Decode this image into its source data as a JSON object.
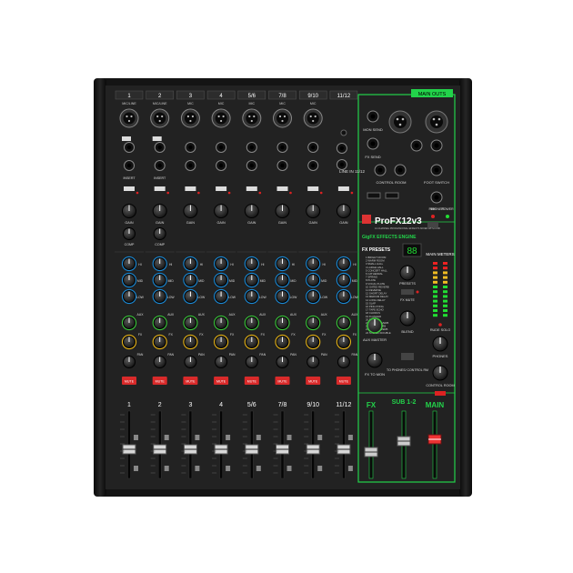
{
  "product": {
    "brand_logo": "mackie-badge-icon",
    "model": "ProFX12v3",
    "tagline": "12-CHANNEL PROFESSIONAL EFFECTS MIXER WITH USB",
    "fx_engine_label": "GigFX EFFECTS ENGINE"
  },
  "channels": [
    {
      "num": "1",
      "top": "MIC/LINE"
    },
    {
      "num": "2",
      "top": "MIC/LINE"
    },
    {
      "num": "3",
      "top": "MIC"
    },
    {
      "num": "4",
      "top": "MIC"
    },
    {
      "num": "5/6",
      "top": "MIC"
    },
    {
      "num": "7/8",
      "top": "MIC"
    },
    {
      "num": "9/10",
      "top": "MIC"
    },
    {
      "num": "11/12",
      "top": ""
    }
  ],
  "channel_labels": {
    "insert": "INSERT",
    "gain": "GAIN",
    "comp": "COMP",
    "eq_hi": "HI",
    "eq_mid": "MID",
    "eq_low": "LOW",
    "aux": "AUX",
    "fx": "FX",
    "pan": "PAN",
    "mute": "MUTE",
    "line_in_11_12": "LINE IN 11/12"
  },
  "main_section": {
    "main_outs": "MAIN OUTS",
    "mon_send": "MON SEND",
    "fx_send": "FX SEND",
    "control_room": "CONTROL ROOM",
    "foot_switch": "FOOT SWITCH",
    "phones": "PHONES",
    "power_48v": "48V",
    "power": "POWER",
    "fx_presets": "FX PRESETS",
    "preset_display": "88",
    "presets": "PRESETS",
    "fx_mute": "FX MUTE",
    "main_meters": "MAIN METERS",
    "blend": "BLEND",
    "rude_solo": "RUDE SOLO",
    "aux_master": "AUX MASTER",
    "fx_to_mon": "FX TO MON",
    "to_phones": "TO PHONES/ CONTROL RM",
    "control_room_knob": "CONTROL ROOM",
    "phones_knob": "PHONES",
    "fader_fx": "FX",
    "fader_sub": "SUB 1-2",
    "fader_main": "MAIN"
  },
  "fx_preset_list": [
    "BRIGHT ROOM",
    "WARM ROOM",
    "SMALL HALL",
    "LARGE HALL",
    "CONCERT HALL",
    "CATHEDRAL",
    "SPRING",
    "PLATE",
    "VOCAL PLATE",
    "GATED REVERB",
    "REVERSE",
    "SHORT DELAY",
    "MEDIUM DELAY",
    "LONG DELAY",
    "SLAP",
    "PING PONG",
    "TAPE ECHO",
    "CHORUS",
    "FLANGER",
    "PHASER",
    "CHORUS+VERB",
    "DELAY+VERB",
    "FLANGE+VERB",
    "STEREO DOUBLE"
  ],
  "colors": {
    "chassis": "#1c1c1c",
    "panel": "#232323",
    "accent_green": "#22d34a",
    "eq_blue": "#1b8ad6",
    "aux_green": "#3cc83c",
    "fx_yellow": "#e8b51a",
    "mute_red": "#d92a2a"
  }
}
